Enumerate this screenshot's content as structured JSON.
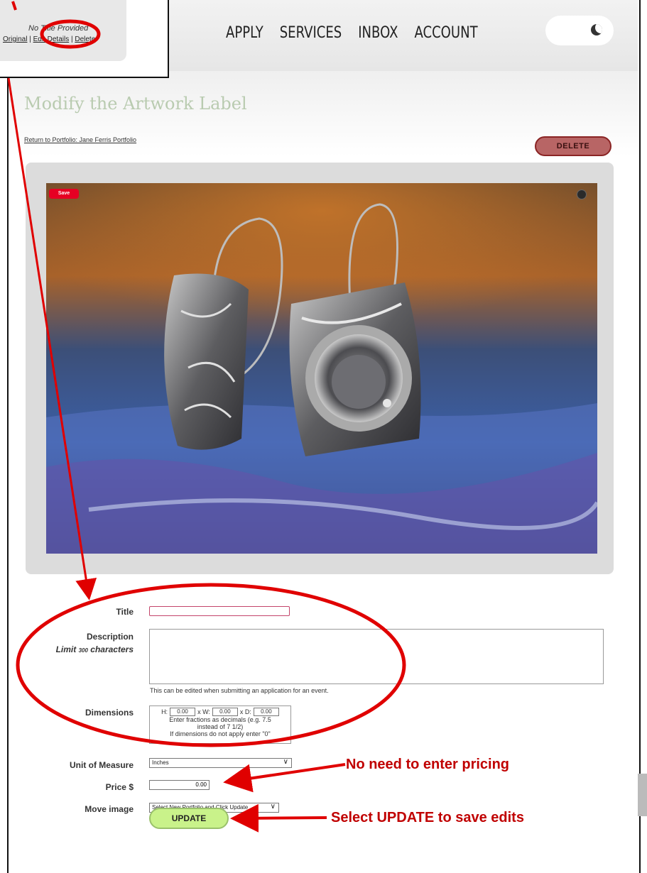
{
  "inset": {
    "title": "No Title Provided",
    "links": [
      "Original",
      "Edit Details",
      "Delete"
    ]
  },
  "nav": {
    "items": [
      "APPLY",
      "SERVICES",
      "INBOX",
      "ACCOUNT"
    ],
    "theme_toggle_icon": "moon-icon"
  },
  "page": {
    "title": "Modify the Artwork Label",
    "return_link": "Return to Portfolio: Jane Ferris Portfolio",
    "delete_label": "DELETE"
  },
  "image": {
    "save_label": "Save",
    "lens_icon": "visual-search-icon"
  },
  "form": {
    "title_label": "Title",
    "title_value": "",
    "description_label": "Description",
    "limit_prefix": "Limit",
    "limit_count": "300",
    "limit_suffix": "characters",
    "description_help": "This can be edited when submitting an application for an event.",
    "dimensions_label": "Dimensions",
    "dim_h_label": "H:",
    "dim_w_label": "x W:",
    "dim_d_label": "x D:",
    "dim_h": "0.00",
    "dim_w": "0.00",
    "dim_d": "0.00",
    "dim_help_1": "Enter fractions as decimals (e.g. 7.5",
    "dim_help_2": "instead of 7 1/2)",
    "dim_help_3": "If dimensions do not apply enter \"0\"",
    "unit_label": "Unit of Measure",
    "unit_value": "Inches",
    "price_label": "Price $",
    "price_value": "0.00",
    "move_label": "Move image",
    "move_value": "Select New Portfolio and Click Update",
    "update_label": "UPDATE"
  },
  "callouts": {
    "pricing": "No need to enter pricing",
    "update": "Select UPDATE to save edits"
  },
  "colors": {
    "annotation_red": "#e00000",
    "delete_button": "#b86565",
    "update_button": "#c9f28a",
    "title_color": "#b9cbb0"
  }
}
